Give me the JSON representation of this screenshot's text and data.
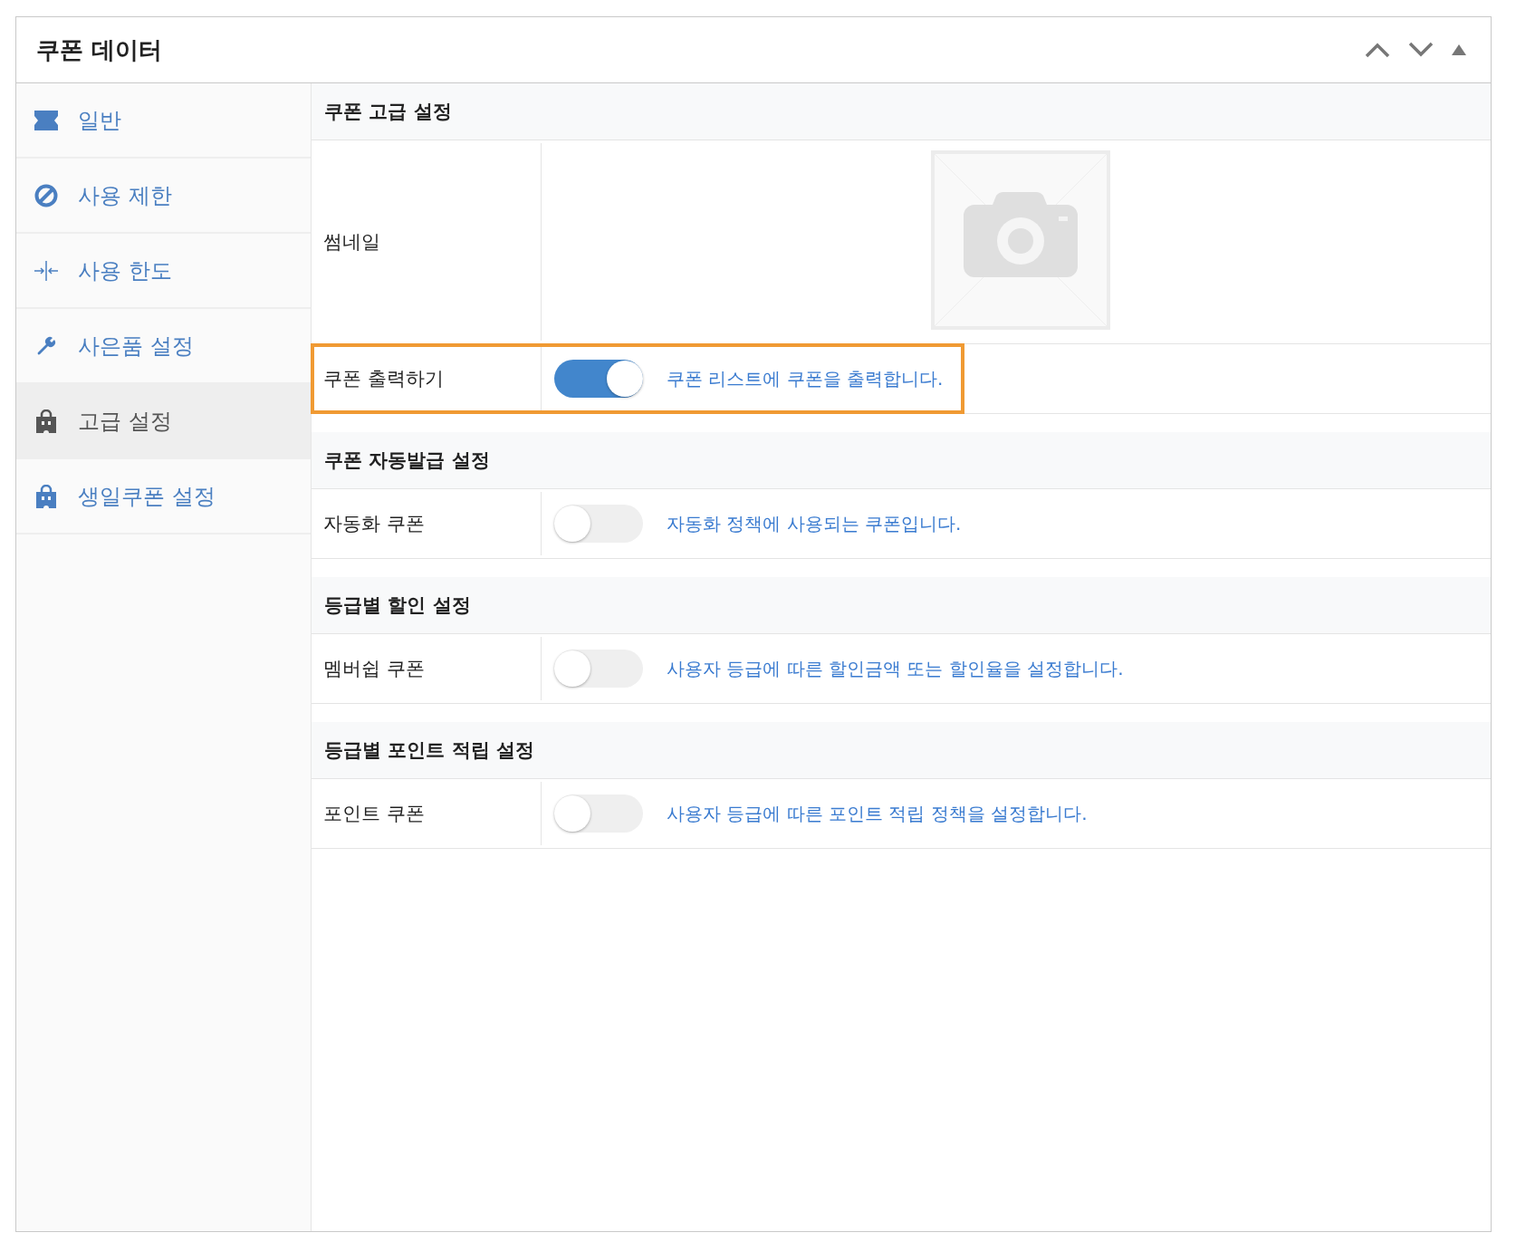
{
  "panel": {
    "title": "쿠폰 데이터"
  },
  "sidebar": {
    "items": [
      {
        "label": "일반",
        "selected": false
      },
      {
        "label": "사용 제한",
        "selected": false
      },
      {
        "label": "사용 한도",
        "selected": false
      },
      {
        "label": "사은품 설정",
        "selected": false
      },
      {
        "label": "고급 설정",
        "selected": true
      },
      {
        "label": "생일쿠폰 설정",
        "selected": false
      }
    ]
  },
  "sections": [
    {
      "title": "쿠폰 고급 설정",
      "rows": [
        {
          "kind": "image",
          "label": "썸네일",
          "highlighted": false
        },
        {
          "kind": "toggle",
          "label": "쿠폰 출력하기",
          "on": true,
          "highlighted": true,
          "description": "쿠폰 리스트에 쿠폰을 출력합니다."
        }
      ]
    },
    {
      "title": "쿠폰 자동발급 설정",
      "rows": [
        {
          "kind": "toggle",
          "label": "자동화 쿠폰",
          "on": false,
          "highlighted": false,
          "description": "자동화 정책에 사용되는 쿠폰입니다."
        }
      ]
    },
    {
      "title": "등급별 할인 설정",
      "rows": [
        {
          "kind": "toggle",
          "label": "멤버쉽 쿠폰",
          "on": false,
          "highlighted": false,
          "description": "사용자 등급에 따른 할인금액 또는 할인율을 설정합니다."
        }
      ]
    },
    {
      "title": "등급별 포인트 적립 설정",
      "rows": [
        {
          "kind": "toggle",
          "label": "포인트 쿠폰",
          "on": false,
          "highlighted": false,
          "description": "사용자 등급에 따른 포인트 적립 정책을 설정합니다."
        }
      ]
    }
  ]
}
